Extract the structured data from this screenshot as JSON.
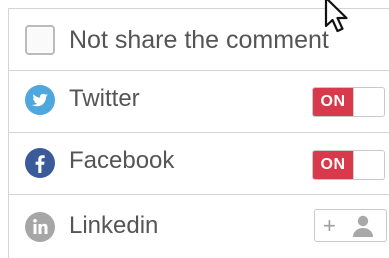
{
  "options": {
    "not_share_label": "Not share the comment"
  },
  "networks": [
    {
      "name": "Twitter",
      "icon": "twitter-icon",
      "color": "#4ea7dd",
      "toggle_label": "ON",
      "enabled": true
    },
    {
      "name": "Facebook",
      "icon": "facebook-icon",
      "color": "#3b5a9a",
      "toggle_label": "ON",
      "enabled": true
    },
    {
      "name": "Linkedin",
      "icon": "linkedin-icon",
      "color": "#9e9e9e",
      "action_label": "+",
      "enabled": false
    }
  ],
  "colors": {
    "toggle_on": "#d83a4c",
    "divider": "#d4d4d4",
    "text": "#555555"
  }
}
